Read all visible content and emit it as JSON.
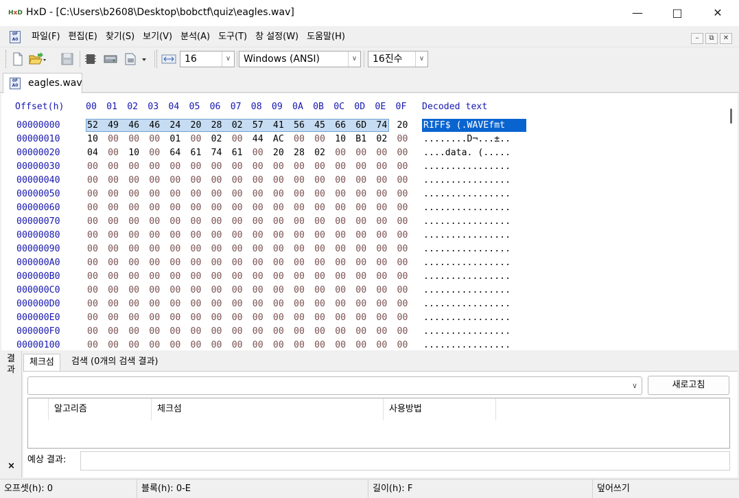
{
  "window": {
    "app_icon": "hxd-logo-icon",
    "title": "HxD - [C:\\Users\\b2608\\Desktop\\bobctf\\quiz\\eagles.wav]",
    "controls": [
      "minimize-icon",
      "maximize-icon",
      "close-icon"
    ]
  },
  "menu": {
    "items": [
      "파일(F)",
      "편집(E)",
      "찾기(S)",
      "보기(V)",
      "분석(A)",
      "도구(T)",
      "창 설정(W)",
      "도움말(H)"
    ],
    "mdi_controls": [
      "minimize-icon",
      "restore-icon",
      "close-icon"
    ]
  },
  "toolbar": {
    "icons": [
      "new-file-icon",
      "open-folder-icon",
      "save-icon",
      "ram-icon",
      "disk-icon",
      "disk-image-icon"
    ],
    "bytes_per_row": "16",
    "charset": "Windows (ANSI)",
    "number_base": "16진수"
  },
  "doc_tab": {
    "label": "eagles.wav"
  },
  "hex": {
    "offset_header": "Offset(h)",
    "columns": [
      "00",
      "01",
      "02",
      "03",
      "04",
      "05",
      "06",
      "07",
      "08",
      "09",
      "0A",
      "0B",
      "0C",
      "0D",
      "0E",
      "0F"
    ],
    "decoded_header": "Decoded text",
    "selection": {
      "start_offset": "0",
      "end_offset": "E"
    },
    "rows": [
      {
        "offset": "00000000",
        "bytes": [
          "52",
          "49",
          "46",
          "46",
          "24",
          "20",
          "28",
          "02",
          "57",
          "41",
          "56",
          "45",
          "66",
          "6D",
          "74",
          "20"
        ],
        "text": "RIFF$ (.WAVEfmt "
      },
      {
        "offset": "00000010",
        "bytes": [
          "10",
          "00",
          "00",
          "00",
          "01",
          "00",
          "02",
          "00",
          "44",
          "AC",
          "00",
          "00",
          "10",
          "B1",
          "02",
          "00"
        ],
        "text": "........D¬...±.."
      },
      {
        "offset": "00000020",
        "bytes": [
          "04",
          "00",
          "10",
          "00",
          "64",
          "61",
          "74",
          "61",
          "00",
          "20",
          "28",
          "02",
          "00",
          "00",
          "00",
          "00"
        ],
        "text": "....data. (....."
      },
      {
        "offset": "00000030",
        "bytes": [
          "00",
          "00",
          "00",
          "00",
          "00",
          "00",
          "00",
          "00",
          "00",
          "00",
          "00",
          "00",
          "00",
          "00",
          "00",
          "00"
        ],
        "text": "................"
      },
      {
        "offset": "00000040",
        "bytes": [
          "00",
          "00",
          "00",
          "00",
          "00",
          "00",
          "00",
          "00",
          "00",
          "00",
          "00",
          "00",
          "00",
          "00",
          "00",
          "00"
        ],
        "text": "................"
      },
      {
        "offset": "00000050",
        "bytes": [
          "00",
          "00",
          "00",
          "00",
          "00",
          "00",
          "00",
          "00",
          "00",
          "00",
          "00",
          "00",
          "00",
          "00",
          "00",
          "00"
        ],
        "text": "................"
      },
      {
        "offset": "00000060",
        "bytes": [
          "00",
          "00",
          "00",
          "00",
          "00",
          "00",
          "00",
          "00",
          "00",
          "00",
          "00",
          "00",
          "00",
          "00",
          "00",
          "00"
        ],
        "text": "................"
      },
      {
        "offset": "00000070",
        "bytes": [
          "00",
          "00",
          "00",
          "00",
          "00",
          "00",
          "00",
          "00",
          "00",
          "00",
          "00",
          "00",
          "00",
          "00",
          "00",
          "00"
        ],
        "text": "................"
      },
      {
        "offset": "00000080",
        "bytes": [
          "00",
          "00",
          "00",
          "00",
          "00",
          "00",
          "00",
          "00",
          "00",
          "00",
          "00",
          "00",
          "00",
          "00",
          "00",
          "00"
        ],
        "text": "................"
      },
      {
        "offset": "00000090",
        "bytes": [
          "00",
          "00",
          "00",
          "00",
          "00",
          "00",
          "00",
          "00",
          "00",
          "00",
          "00",
          "00",
          "00",
          "00",
          "00",
          "00"
        ],
        "text": "................"
      },
      {
        "offset": "000000A0",
        "bytes": [
          "00",
          "00",
          "00",
          "00",
          "00",
          "00",
          "00",
          "00",
          "00",
          "00",
          "00",
          "00",
          "00",
          "00",
          "00",
          "00"
        ],
        "text": "................"
      },
      {
        "offset": "000000B0",
        "bytes": [
          "00",
          "00",
          "00",
          "00",
          "00",
          "00",
          "00",
          "00",
          "00",
          "00",
          "00",
          "00",
          "00",
          "00",
          "00",
          "00"
        ],
        "text": "................"
      },
      {
        "offset": "000000C0",
        "bytes": [
          "00",
          "00",
          "00",
          "00",
          "00",
          "00",
          "00",
          "00",
          "00",
          "00",
          "00",
          "00",
          "00",
          "00",
          "00",
          "00"
        ],
        "text": "................"
      },
      {
        "offset": "000000D0",
        "bytes": [
          "00",
          "00",
          "00",
          "00",
          "00",
          "00",
          "00",
          "00",
          "00",
          "00",
          "00",
          "00",
          "00",
          "00",
          "00",
          "00"
        ],
        "text": "................"
      },
      {
        "offset": "000000E0",
        "bytes": [
          "00",
          "00",
          "00",
          "00",
          "00",
          "00",
          "00",
          "00",
          "00",
          "00",
          "00",
          "00",
          "00",
          "00",
          "00",
          "00"
        ],
        "text": "................"
      },
      {
        "offset": "000000F0",
        "bytes": [
          "00",
          "00",
          "00",
          "00",
          "00",
          "00",
          "00",
          "00",
          "00",
          "00",
          "00",
          "00",
          "00",
          "00",
          "00",
          "00"
        ],
        "text": "................"
      },
      {
        "offset": "00000100",
        "bytes": [
          "00",
          "00",
          "00",
          "00",
          "00",
          "00",
          "00",
          "00",
          "00",
          "00",
          "00",
          "00",
          "00",
          "00",
          "00",
          "00"
        ],
        "text": "................"
      }
    ]
  },
  "results": {
    "side_label": "결과",
    "close": "×",
    "tabs": [
      "체크섬",
      "검색 (0개의 검색 결과)"
    ],
    "refresh_label": "새로고침",
    "columns": [
      "알고리즘",
      "체크섬",
      "사용방법"
    ],
    "expected_label": "예상 결과:",
    "expected_value": ""
  },
  "status": {
    "offset": "오프셋(h): 0",
    "block": "블록(h): 0-E",
    "length": "길이(h): F",
    "mode": "덮어쓰기"
  },
  "colors": {
    "offset_blue": "#1616b0",
    "selection_hex_bg": "#c6dcf2",
    "selection_text_bg": "#0a64d0",
    "zero_byte": "#7a5050"
  }
}
